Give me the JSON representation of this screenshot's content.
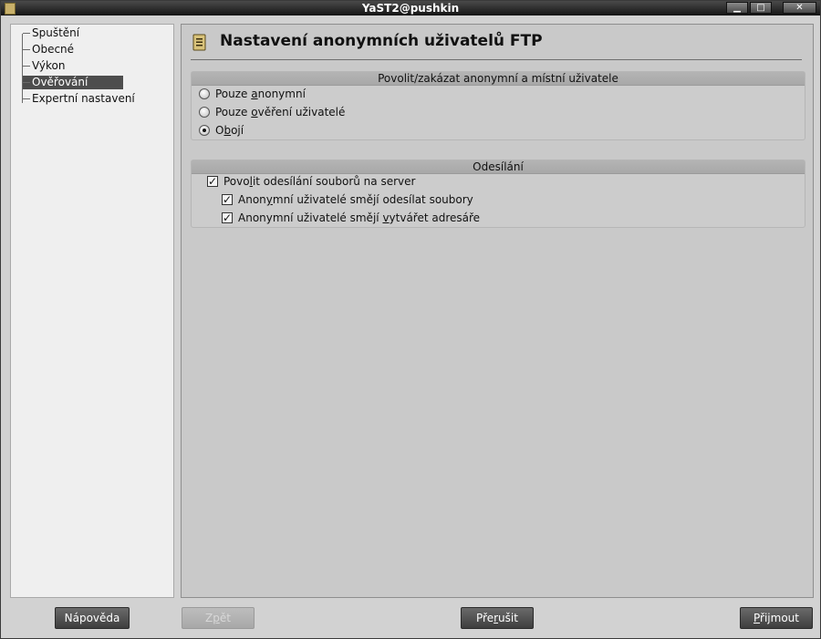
{
  "window": {
    "title": "YaST2@pushkin",
    "controls": [
      "minimize-icon",
      "maximize-icon",
      "close-icon"
    ]
  },
  "sidebar": {
    "items": [
      {
        "label": "Spuštění",
        "selected": false
      },
      {
        "label": "Obecné",
        "selected": false
      },
      {
        "label": "Výkon",
        "selected": false
      },
      {
        "label": "Ověřování",
        "selected": true
      },
      {
        "label": "Expertní nastavení",
        "selected": false
      }
    ]
  },
  "header": {
    "title": "Nastavení anonymních uživatelů FTP",
    "icon": "ftp-settings-icon"
  },
  "access_group": {
    "title": "Povolit/zakázat anonymní a místní uživatele",
    "options": [
      {
        "pre": "Pouze ",
        "mnemonic": "a",
        "post": "nonymní",
        "checked": false
      },
      {
        "pre": "Pouze ",
        "mnemonic": "o",
        "post": "věření uživatelé",
        "checked": false
      },
      {
        "pre": "O",
        "mnemonic": "b",
        "post": "ojí",
        "checked": true
      }
    ]
  },
  "upload_group": {
    "title": "Odesílání",
    "options": [
      {
        "pre": "Povo",
        "mnemonic": "l",
        "post": "it odesílání souborů na server",
        "checked": true
      },
      {
        "pre": "Anon",
        "mnemonic": "y",
        "post": "mní uživatelé smějí odesílat soubory",
        "checked": true
      },
      {
        "pre": "Anonymní uživatelé smějí ",
        "mnemonic": "v",
        "post": "ytvářet adresáře",
        "checked": true
      }
    ]
  },
  "buttons": {
    "help": "Nápověda",
    "back": {
      "pre": "Z",
      "mnemonic": "p",
      "post": "ět",
      "enabled": false
    },
    "abort": {
      "pre": "Pře",
      "mnemonic": "r",
      "post": "ušit"
    },
    "accept": {
      "pre": "",
      "mnemonic": "P",
      "post": "řijmout"
    }
  }
}
